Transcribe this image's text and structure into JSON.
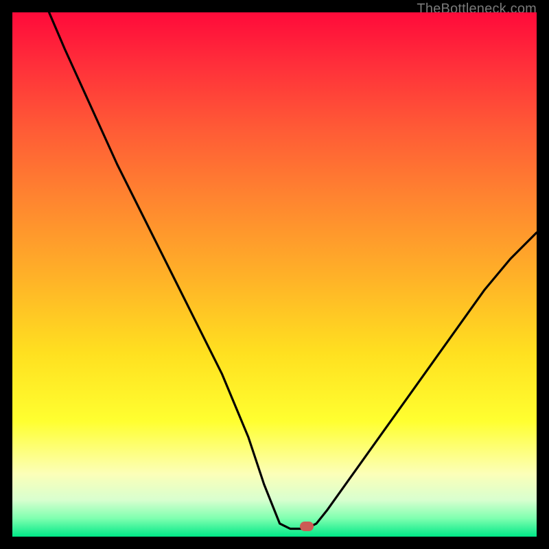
{
  "watermark": {
    "text": "TheBottleneck.com"
  },
  "marker": {
    "x_frac": 0.561,
    "y_frac": 0.981
  },
  "chart_data": {
    "type": "line",
    "title": "",
    "xlabel": "",
    "ylabel": "",
    "xlim": [
      0,
      100
    ],
    "ylim": [
      0,
      100
    ],
    "grid": false,
    "series": [
      {
        "name": "bottleneck-curve",
        "x": [
          7,
          10,
          15,
          20,
          25,
          30,
          35,
          40,
          45,
          48,
          51,
          53,
          55,
          56,
          58,
          60,
          65,
          70,
          75,
          80,
          85,
          90,
          95,
          100
        ],
        "y": [
          100,
          93,
          82,
          71,
          61,
          51,
          41,
          31,
          19,
          10,
          2.5,
          1.5,
          1.5,
          1.5,
          2.5,
          5,
          12,
          19,
          26,
          33,
          40,
          47,
          53,
          58
        ]
      }
    ],
    "annotations": [
      {
        "type": "marker",
        "x": 56.1,
        "y": 1.9,
        "label": "optimal-point"
      }
    ],
    "background_gradient": {
      "orientation": "vertical",
      "stops": [
        {
          "pos": 0.0,
          "color": "#ff0a3a"
        },
        {
          "pos": 0.35,
          "color": "#ff8330"
        },
        {
          "pos": 0.65,
          "color": "#ffe020"
        },
        {
          "pos": 0.88,
          "color": "#fcffb8"
        },
        {
          "pos": 1.0,
          "color": "#00e887"
        }
      ]
    }
  }
}
